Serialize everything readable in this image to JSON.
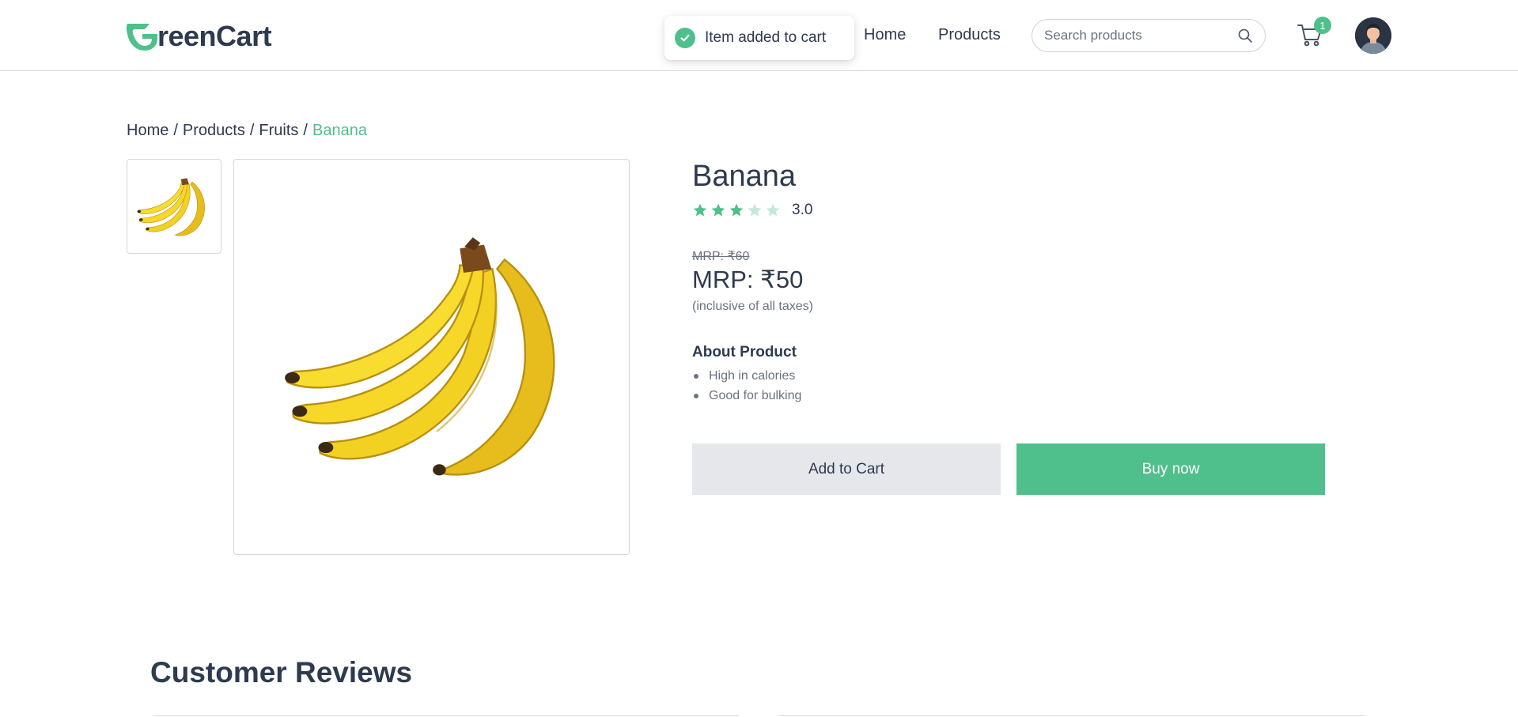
{
  "brand": {
    "name": "reenCart",
    "accent": "#4fbf8b",
    "text_color": "#2e3a4e"
  },
  "nav": {
    "home": "Home",
    "products": "Products"
  },
  "search": {
    "placeholder": "Search products"
  },
  "cart": {
    "count": "1",
    "icon": "cart-icon"
  },
  "toast": {
    "message": "Item added to cart",
    "icon": "check-circle-icon"
  },
  "breadcrumb": {
    "items": [
      "Home",
      "Products",
      "Fruits"
    ],
    "separator": "/",
    "current": "Banana"
  },
  "product": {
    "name": "Banana",
    "rating": 3,
    "rating_max": 5,
    "rating_label": "3.0",
    "mrp_old": "MRP: ₹60",
    "mrp": "MRP: ₹50",
    "tax_note": "(inclusive of all taxes)",
    "about_title": "About Product",
    "about_items": [
      "High in calories",
      "Good for bulking"
    ],
    "image": "banana-image"
  },
  "actions": {
    "add_to_cart": "Add to Cart",
    "buy_now": "Buy now"
  },
  "reviews": {
    "title": "Customer Reviews"
  }
}
